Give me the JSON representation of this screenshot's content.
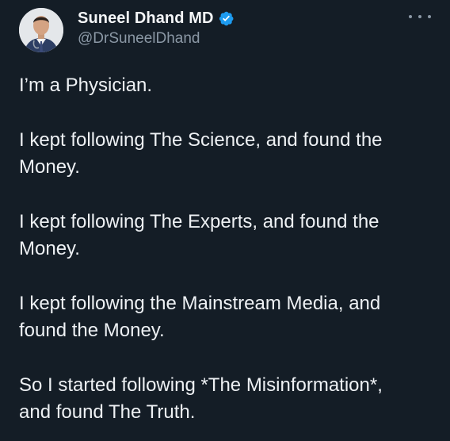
{
  "author": {
    "display_name": "Suneel Dhand MD",
    "handle": "@DrSuneelDhand",
    "verified_icon": "verified-badge-icon",
    "avatar_icon": "avatar-photo"
  },
  "menu": {
    "icon": "more-options-icon"
  },
  "colors": {
    "background": "#141d26",
    "verified": "#1d9bf0",
    "secondary_text": "#8b98a5"
  },
  "tweet": {
    "paragraphs": [
      "I’m a Physician.",
      "I kept following The Science, and found the\nMoney.",
      "I kept following The Experts, and found the\nMoney.",
      "I kept following the Mainstream Media, and\nfound the Money.",
      "So I started following *The Misinformation*,\nand found The Truth."
    ]
  }
}
